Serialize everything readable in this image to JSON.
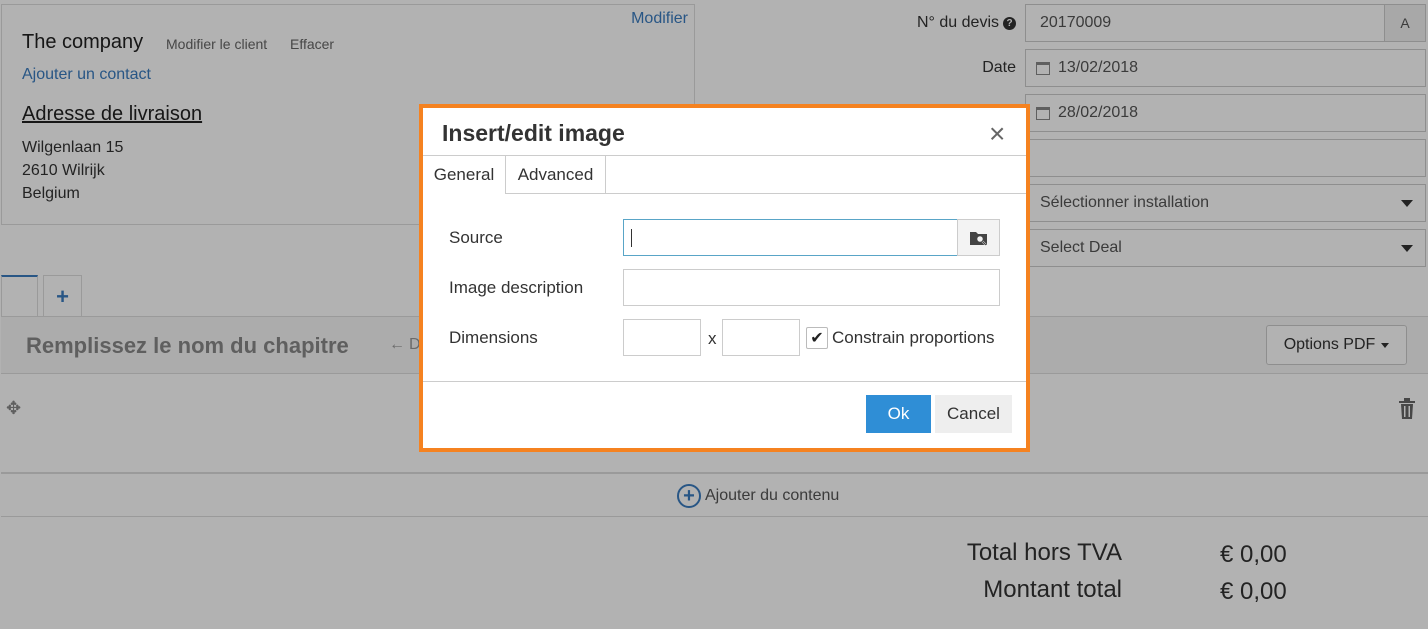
{
  "client": {
    "edit_link": "Modifier",
    "company_name": "The company",
    "modify_client": "Modifier le client",
    "clear": "Effacer",
    "add_contact": "Ajouter un contact",
    "delivery_title": "Adresse de livraison",
    "address": [
      "Wilgenlaan 15",
      "2610 Wilrijk",
      "Belgium"
    ]
  },
  "quote": {
    "number_label": "N° du devis",
    "number_value": "20170009",
    "number_addon": "A",
    "date_label": "Date",
    "date_value": "13/02/2018",
    "due_value": "28/02/2018",
    "installation_placeholder": "Sélectionner installation",
    "deal_placeholder": "Select Deal"
  },
  "tabs": {
    "add_symbol": "+"
  },
  "chapter": {
    "title_placeholder": "Remplissez le nom du chapitre",
    "nav_partial": "De",
    "pdf_options": "Options PDF"
  },
  "content": {
    "add_content": "Ajouter du contenu"
  },
  "totals": {
    "excl_vat_label": "Total hors TVA",
    "excl_vat_value": "€ 0,00",
    "total_label": "Montant total",
    "total_value": "€ 0,00"
  },
  "dialog": {
    "title": "Insert/edit image",
    "close_symbol": "×",
    "tabs": [
      {
        "label": "General",
        "active": true
      },
      {
        "label": "Advanced",
        "active": false
      }
    ],
    "source_label": "Source",
    "source_value": "",
    "description_label": "Image description",
    "description_value": "",
    "dimensions_label": "Dimensions",
    "width_value": "",
    "height_value": "",
    "times_symbol": "x",
    "constrain_label": "Constrain proportions",
    "constrain_checked": true,
    "ok_label": "Ok",
    "cancel_label": "Cancel"
  },
  "colors": {
    "accent": "#3a7bbf",
    "dialog_border": "#f58220",
    "ok_button": "#2f8ed6"
  },
  "icons": [
    "question-circle-icon",
    "calendar-icon",
    "caret-down-icon",
    "move-handle-icon",
    "trash-icon",
    "plus-circle-icon",
    "arrow-left-icon",
    "browse-image-icon",
    "check-icon",
    "close-icon"
  ]
}
